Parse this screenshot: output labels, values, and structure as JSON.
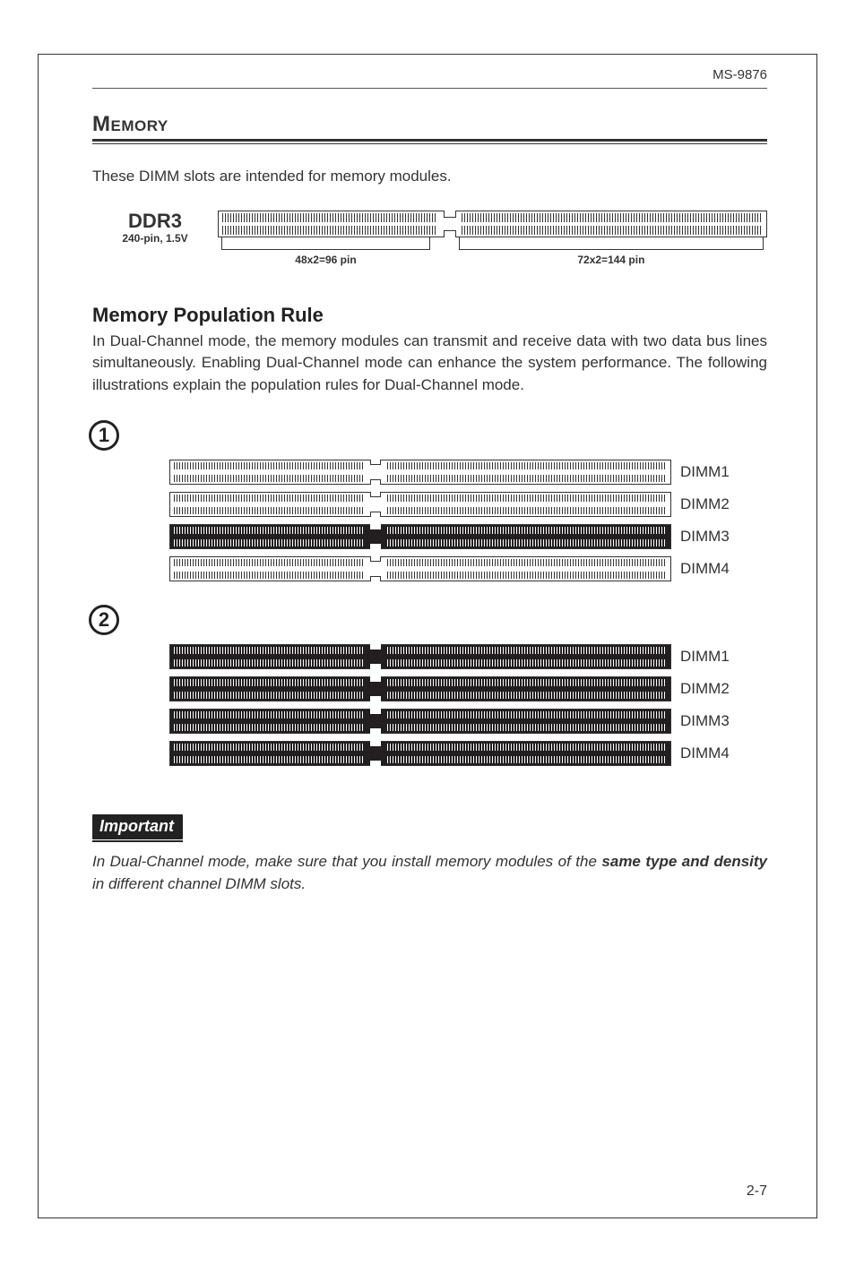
{
  "header": {
    "model": "MS-9876"
  },
  "memory": {
    "heading": "Memory",
    "intro": "These DIMM slots are intended for memory modules.",
    "ddr": {
      "label_big": "DDR3",
      "label_small": "240-pin, 1.5V",
      "left_bracket": "48x2=96 pin",
      "right_bracket": "72x2=144  pin"
    },
    "rule": {
      "heading": "Memory Population Rule",
      "paragraph": "In Dual-Channel mode, the memory modules can transmit and receive data with two data bus lines simultaneously. Enabling Dual-Channel mode can enhance the system performance. The following illustrations explain the population rules for Dual-Channel mode."
    },
    "configs": [
      {
        "num": "1",
        "slots": [
          {
            "label": "DIMM1",
            "filled": false
          },
          {
            "label": "DIMM2",
            "filled": false
          },
          {
            "label": "DIMM3",
            "filled": true
          },
          {
            "label": "DIMM4",
            "filled": false
          }
        ]
      },
      {
        "num": "2",
        "slots": [
          {
            "label": "DIMM1",
            "filled": true
          },
          {
            "label": "DIMM2",
            "filled": true
          },
          {
            "label": "DIMM3",
            "filled": true
          },
          {
            "label": "DIMM4",
            "filled": true
          }
        ]
      }
    ],
    "important": {
      "badge": "Important",
      "text_pre": "In Dual-Channel mode, make sure that you install memory modules of the ",
      "text_bold": "same type and density",
      "text_post": " in different channel DIMM slots."
    }
  },
  "footer": {
    "page": "2-7"
  },
  "chart_data": {
    "type": "table",
    "title": "DDR3 DIMM pin segmentation and dual-channel population",
    "connector": {
      "pins_total": 240,
      "voltage": "1.5V",
      "segment_left": "48x2=96 pin",
      "segment_right": "72x2=144 pin"
    },
    "populations": [
      {
        "config": 1,
        "DIMM1": "empty",
        "DIMM2": "empty",
        "DIMM3": "populated",
        "DIMM4": "empty"
      },
      {
        "config": 2,
        "DIMM1": "populated",
        "DIMM2": "populated",
        "DIMM3": "populated",
        "DIMM4": "populated"
      }
    ]
  }
}
